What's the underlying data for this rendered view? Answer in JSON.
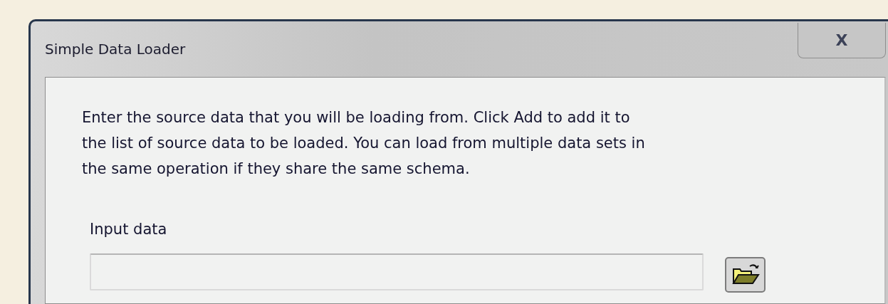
{
  "window": {
    "title": "Simple Data Loader",
    "close_label": "X"
  },
  "description_lines": [
    "Enter the source data that you will be loading from. Click Add to add it to",
    "the list of source data to be loaded. You can load from multiple data sets in",
    "the same operation if they share the same schema."
  ],
  "input": {
    "label": "Input data"
  }
}
